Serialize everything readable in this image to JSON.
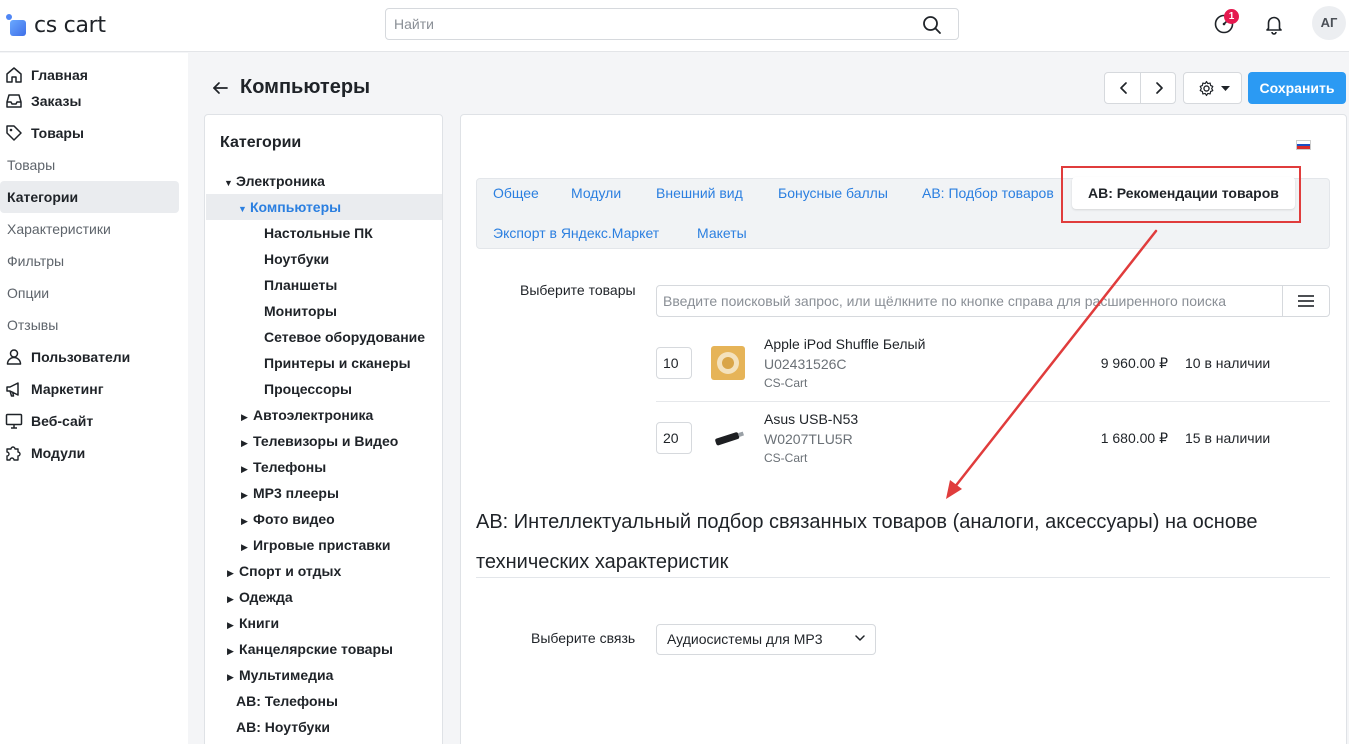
{
  "app": {
    "logo_text": "cs cart"
  },
  "header": {
    "search_placeholder": "Найти",
    "notification_badge": "1",
    "avatar_initials": "АГ"
  },
  "sidebar": {
    "items": [
      {
        "label": "Главная",
        "type": "main",
        "icon": "home-icon"
      },
      {
        "label": "Заказы",
        "type": "main",
        "icon": "inbox-icon"
      },
      {
        "label": "Товары",
        "type": "main",
        "icon": "tag-icon"
      },
      {
        "label": "Товары",
        "type": "sub"
      },
      {
        "label": "Категории",
        "type": "sub",
        "active": true
      },
      {
        "label": "Характеристики",
        "type": "sub"
      },
      {
        "label": "Фильтры",
        "type": "sub"
      },
      {
        "label": "Опции",
        "type": "sub"
      },
      {
        "label": "Отзывы",
        "type": "sub"
      },
      {
        "label": "Пользователи",
        "type": "main",
        "icon": "user-icon"
      },
      {
        "label": "Маркетинг",
        "type": "main",
        "icon": "megaphone-icon"
      },
      {
        "label": "Веб-сайт",
        "type": "main",
        "icon": "monitor-icon"
      },
      {
        "label": "Модули",
        "type": "main",
        "icon": "puzzle-icon"
      }
    ]
  },
  "page": {
    "title": "Компьютеры",
    "save_label": "Сохранить"
  },
  "categories": {
    "title": "Категории",
    "tree": [
      {
        "label": "Электроника",
        "level": 0,
        "caret": "down"
      },
      {
        "label": "Компьютеры",
        "level": 1,
        "caret": "down",
        "current": true
      },
      {
        "label": "Настольные ПК",
        "level": 2
      },
      {
        "label": "Ноутбуки",
        "level": 2
      },
      {
        "label": "Планшеты",
        "level": 2
      },
      {
        "label": "Мониторы",
        "level": 2
      },
      {
        "label": "Сетевое оборудование",
        "level": 2
      },
      {
        "label": "Принтеры и сканеры",
        "level": 2
      },
      {
        "label": "Процессоры",
        "level": 2
      },
      {
        "label": "Автоэлектроника",
        "level": 1,
        "caret": "right"
      },
      {
        "label": "Телевизоры и Видео",
        "level": 1,
        "caret": "right"
      },
      {
        "label": "Телефоны",
        "level": 1,
        "caret": "right"
      },
      {
        "label": "MP3 плееры",
        "level": 1,
        "caret": "right"
      },
      {
        "label": "Фото видео",
        "level": 1,
        "caret": "right"
      },
      {
        "label": "Игровые приставки",
        "level": 1,
        "caret": "right"
      },
      {
        "label": "Спорт и отдых",
        "level": 0,
        "caret": "right"
      },
      {
        "label": "Одежда",
        "level": 0,
        "caret": "right"
      },
      {
        "label": "Книги",
        "level": 0,
        "caret": "right"
      },
      {
        "label": "Канцелярские товары",
        "level": 0,
        "caret": "right"
      },
      {
        "label": "Мультимедиа",
        "level": 0,
        "caret": "right"
      },
      {
        "label": "AB: Телефоны",
        "level": -1
      },
      {
        "label": "AB: Ноутбуки",
        "level": -1
      }
    ]
  },
  "tabs": {
    "row1": [
      "Общее",
      "Модули",
      "Внешний вид",
      "Бонусные баллы",
      "AB: Подбор товаров"
    ],
    "active": "AB: Рекомендации товаров",
    "row2": [
      "Экспорт в Яндекс.Маркет",
      "Макеты"
    ]
  },
  "products_field": {
    "label": "Выберите товары",
    "placeholder": "Введите поисковый запрос, или щёлкните по кнопке справа для расширенного поиска",
    "items": [
      {
        "qty": "10",
        "name": "Apple iPod Shuffle Белый",
        "sku": "U02431526C",
        "vendor": "CS-Cart",
        "price": "9 960.00 ₽",
        "stock": "10 в наличии",
        "image": "ipod-shuffle-image"
      },
      {
        "qty": "20",
        "name": "Asus USB-N53",
        "sku": "W0207TLU5R",
        "vendor": "CS-Cart",
        "price": "1 680.00 ₽",
        "stock": "15 в наличии",
        "image": "usb-adapter-image"
      }
    ]
  },
  "section": {
    "title": "AB: Интеллектуальный подбор связанных товаров (аналоги, аксессуары) на основе технических характеристик"
  },
  "relation_field": {
    "label": "Выберите связь",
    "value": "Аудиосистемы для MP3"
  },
  "colors": {
    "accent": "#2b9af3",
    "link": "#2b7fe0",
    "annotation": "#e03c3c",
    "badge": "#e5194f"
  }
}
